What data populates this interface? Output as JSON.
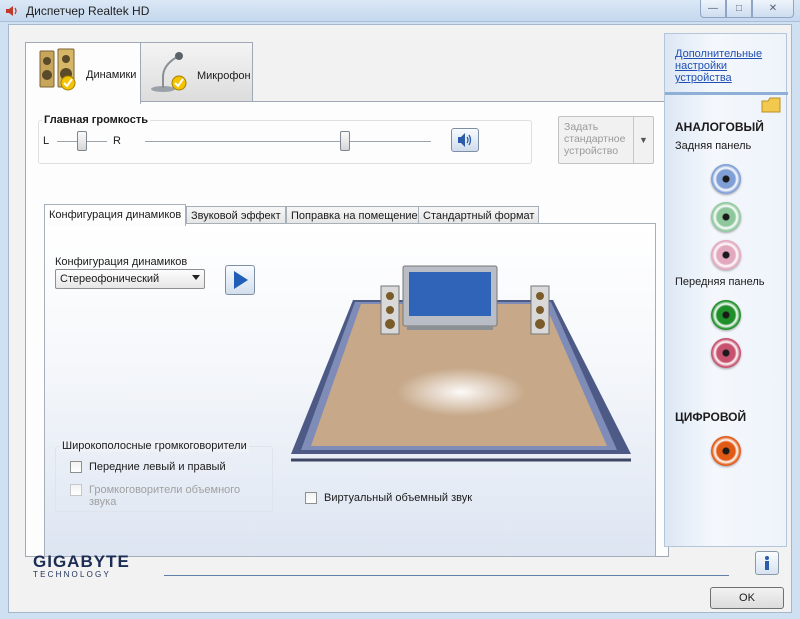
{
  "window": {
    "title": "Диспетчер Realtek HD",
    "controls": {
      "minimize": "—",
      "maximize": "□",
      "close": "✕"
    }
  },
  "device_tabs": [
    {
      "label": "Динамики",
      "icon": "speakers-icon",
      "active": true
    },
    {
      "label": "Микрофон",
      "icon": "microphone-icon",
      "active": false
    }
  ],
  "main_volume": {
    "title": "Главная громкость",
    "balance_left": "L",
    "balance_right": "R",
    "balance_value": 0.5,
    "volume_value": 0.7,
    "mute_icon": "speaker-sound-icon"
  },
  "set_default": {
    "lines": [
      "Задать",
      "стандартное",
      "устройство"
    ],
    "enabled": false
  },
  "inner_tabs": [
    {
      "label": "Конфигурация динамиков",
      "active": true
    },
    {
      "label": "Звуковой эффект",
      "active": false
    },
    {
      "label": "Поправка на помещение",
      "active": false
    },
    {
      "label": "Стандартный формат",
      "active": false
    }
  ],
  "speaker_config": {
    "title": "Конфигурация динамиков",
    "selected": "Стереофонический",
    "play_icon": "play-icon"
  },
  "fullrange": {
    "title": "Широкополосные громкоговорители",
    "front": "Передние левый и правый",
    "surround_lines": [
      "Громкоговорители объемного",
      "звука"
    ],
    "surround_enabled": false
  },
  "virtual_surround": {
    "label": "Виртуальный объемный звук",
    "checked": false
  },
  "side_panel": {
    "link_lines": [
      "Дополнительные",
      "настройки",
      "устройства"
    ],
    "analog_title": "АНАЛОГОВЫЙ",
    "back_panel": "Задняя панель",
    "front_panel": "Передняя панель",
    "digital_title": "ЦИФРОВОЙ",
    "colors": {
      "back_blue": "#7f9fd6",
      "back_green": "#8fc79d",
      "back_pink": "#e2a8bd",
      "front_green": "#1f8f2a",
      "front_pink": "#c7516e",
      "digital": "#e05a16"
    }
  },
  "footer": {
    "brand": "GIGABYTE",
    "brand_sub": "TECHNOLOGY",
    "info_icon": "info-icon",
    "ok": "OK"
  }
}
